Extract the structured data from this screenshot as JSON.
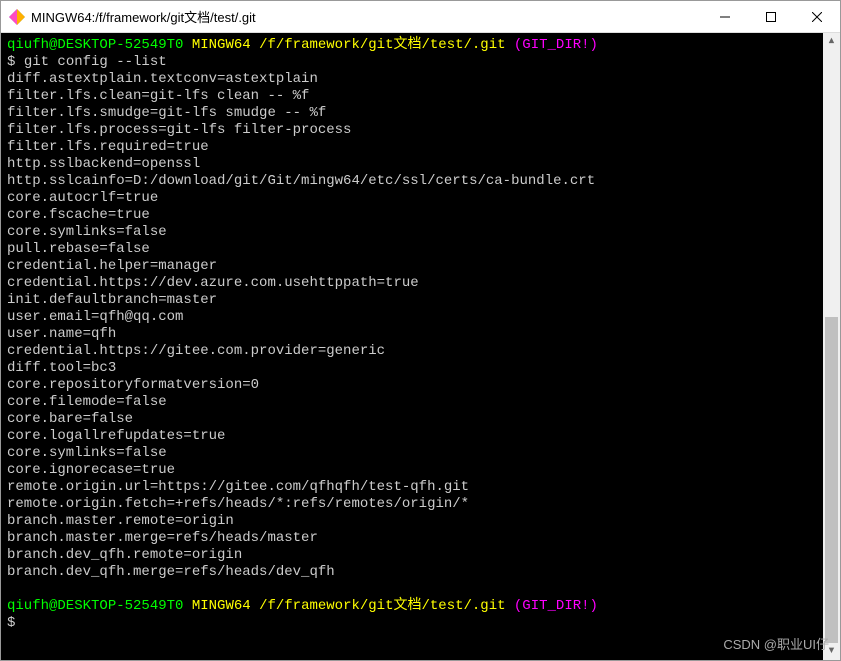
{
  "window": {
    "title": "MINGW64:/f/framework/git文档/test/.git"
  },
  "prompt": {
    "user_host": "qiufh@DESKTOP-52549T0",
    "env": "MINGW64",
    "path": "/f/framework/git文档/test/.git",
    "gitdir": "(GIT_DIR!)",
    "symbol": "$"
  },
  "command": "git config --list",
  "output_lines": [
    "diff.astextplain.textconv=astextplain",
    "filter.lfs.clean=git-lfs clean -- %f",
    "filter.lfs.smudge=git-lfs smudge -- %f",
    "filter.lfs.process=git-lfs filter-process",
    "filter.lfs.required=true",
    "http.sslbackend=openssl",
    "http.sslcainfo=D:/download/git/Git/mingw64/etc/ssl/certs/ca-bundle.crt",
    "core.autocrlf=true",
    "core.fscache=true",
    "core.symlinks=false",
    "pull.rebase=false",
    "credential.helper=manager",
    "credential.https://dev.azure.com.usehttppath=true",
    "init.defaultbranch=master",
    "user.email=qfh@qq.com",
    "user.name=qfh",
    "credential.https://gitee.com.provider=generic",
    "diff.tool=bc3",
    "core.repositoryformatversion=0",
    "core.filemode=false",
    "core.bare=false",
    "core.logallrefupdates=true",
    "core.symlinks=false",
    "core.ignorecase=true",
    "remote.origin.url=https://gitee.com/qfhqfh/test-qfh.git",
    "remote.origin.fetch=+refs/heads/*:refs/remotes/origin/*",
    "branch.master.remote=origin",
    "branch.master.merge=refs/heads/master",
    "branch.dev_qfh.remote=origin",
    "branch.dev_qfh.merge=refs/heads/dev_qfh"
  ],
  "watermark": "CSDN @职业UI仔"
}
